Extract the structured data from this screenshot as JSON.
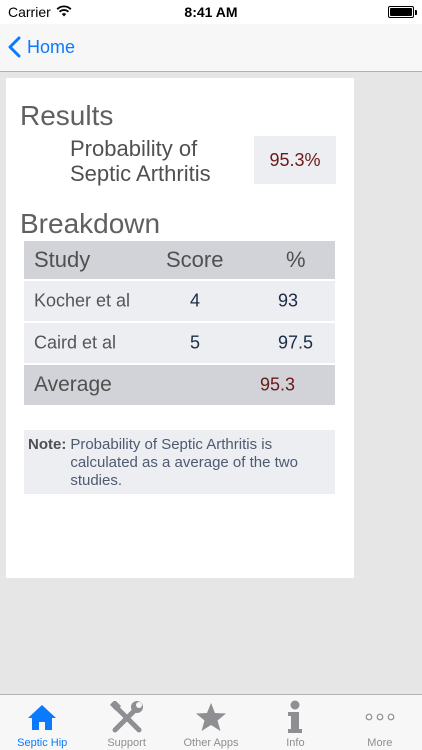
{
  "status_bar": {
    "carrier": "Carrier",
    "time": "8:41 AM"
  },
  "nav": {
    "back_label": "Home"
  },
  "results": {
    "title": "Results",
    "prob_label_line1": "Probability of",
    "prob_label_line2": "Septic Arthritis",
    "prob_value": "95.3%"
  },
  "breakdown": {
    "title": "Breakdown",
    "headers": [
      "Study",
      "Score",
      "%"
    ],
    "rows": [
      {
        "study": "Kocher et al",
        "score": "4",
        "percent": "93"
      },
      {
        "study": "Caird et al",
        "score": "5",
        "percent": "97.5"
      }
    ],
    "average": {
      "label": "Average",
      "percent": "95.3"
    }
  },
  "note": {
    "label": "Note:",
    "text": "Probability of Septic Arthritis is calculated as a average of the two studies."
  },
  "tabs": [
    {
      "label": "Septic Hip",
      "icon": "house-icon",
      "active": true
    },
    {
      "label": "Support",
      "icon": "tools-icon",
      "active": false
    },
    {
      "label": "Other Apps",
      "icon": "star-icon",
      "active": false
    },
    {
      "label": "Info",
      "icon": "info-icon",
      "active": false
    },
    {
      "label": "More",
      "icon": "more-dots-icon",
      "active": false
    }
  ],
  "colors": {
    "accent": "#0a7aff",
    "value_text": "#6b1a1a",
    "header_row": "#d1d3d8",
    "data_row": "#eceef2"
  }
}
